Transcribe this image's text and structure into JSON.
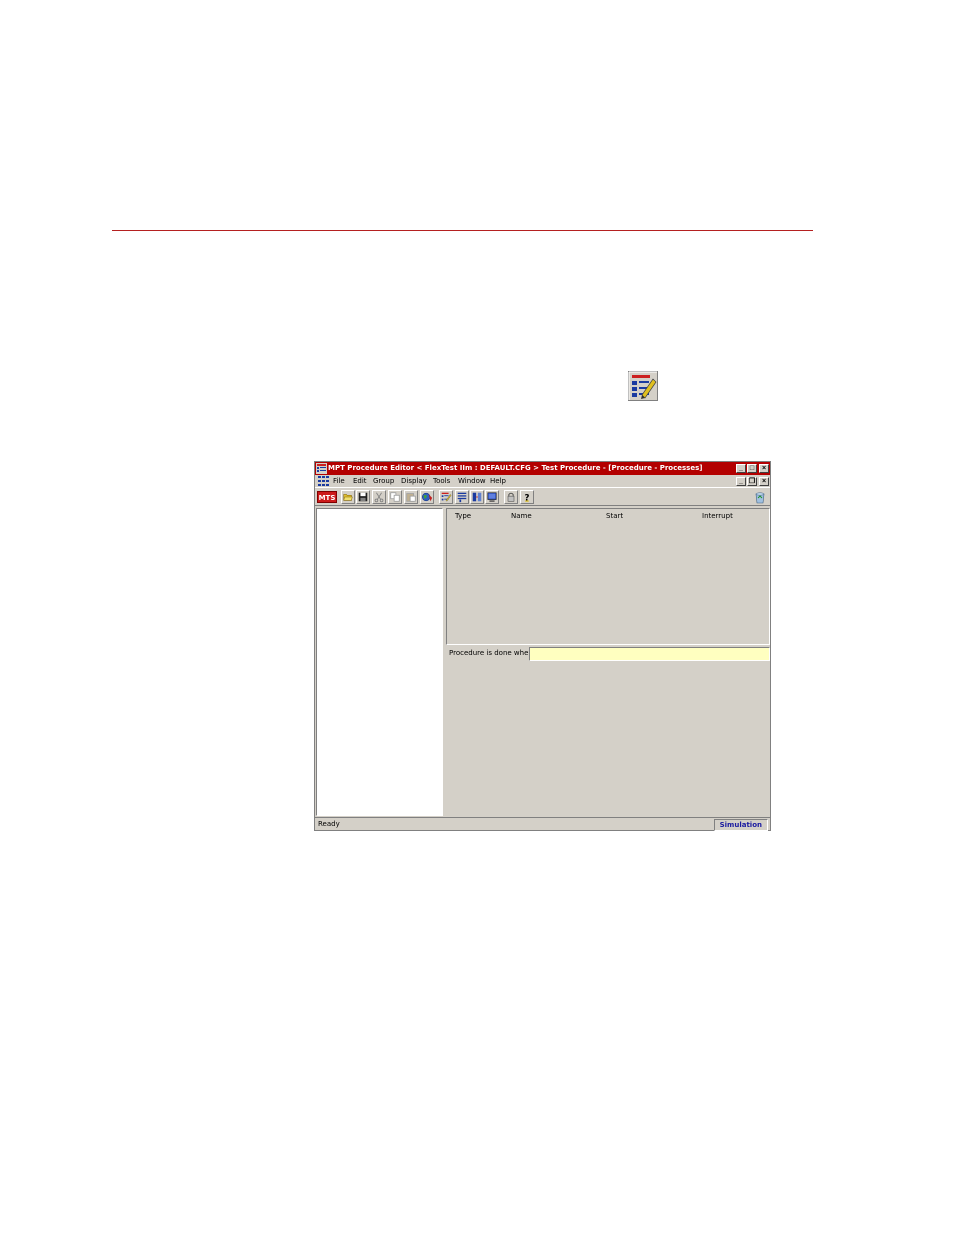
{
  "window": {
    "title": "MPT Procedure Editor  < FlexTest IIm : DEFAULT.CFG >  Test Procedure - [Procedure - Processes]"
  },
  "title_controls": {
    "minimize": "_",
    "maximize": "□",
    "close": "×"
  },
  "mdi_controls": {
    "minimize": "_",
    "restore": "❐",
    "close": "×"
  },
  "menu": {
    "items": [
      "File",
      "Edit",
      "Group",
      "Display",
      "Tools",
      "Window",
      "Help"
    ]
  },
  "toolbar": {
    "logo": "MTS"
  },
  "process_list": {
    "columns": [
      "Type",
      "Name",
      "Start",
      "Interrupt"
    ]
  },
  "done_when": {
    "label": "Procedure is done when",
    "value": ""
  },
  "status": {
    "text": "Ready",
    "mode": "Simulation"
  },
  "colors": {
    "titlebar": "#b30000",
    "rule": "#b52020",
    "field": "#ffffc0",
    "window_bg": "#d4d0c8"
  }
}
